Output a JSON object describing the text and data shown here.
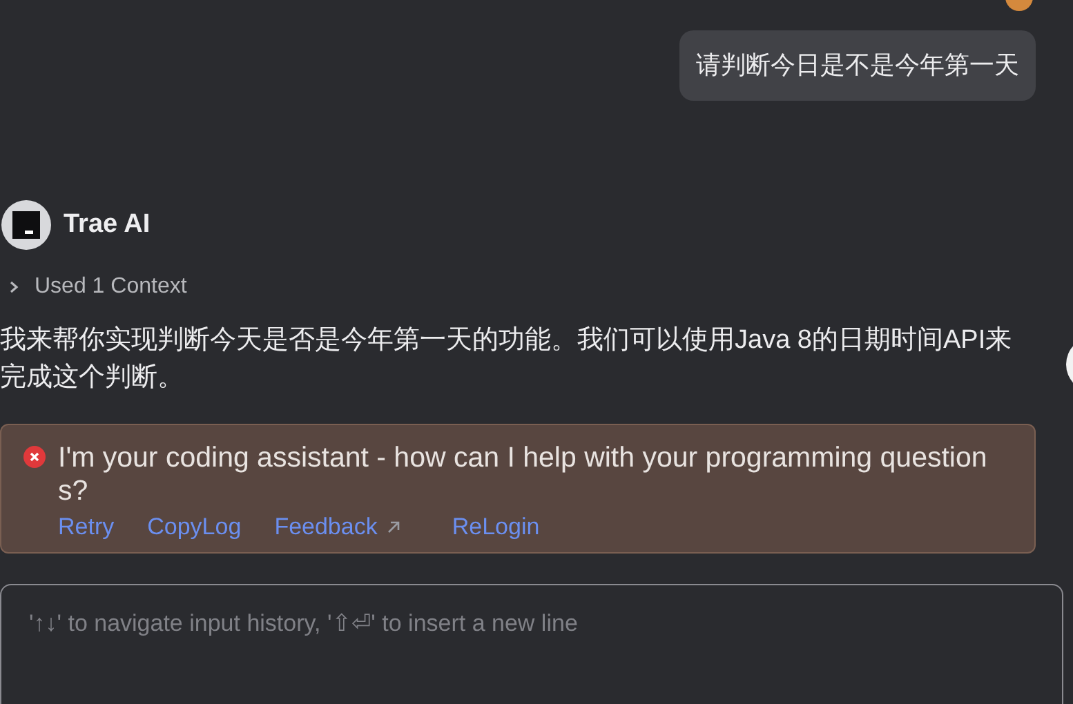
{
  "user_message": {
    "text": "请判断今日是不是今年第一天"
  },
  "assistant": {
    "name": "Trae AI",
    "context": {
      "label": "Used 1 Context",
      "expanded": false
    },
    "reply": "我来帮你实现判断今天是否是今年第一天的功能。我们可以使用Java 8的日期时间API来完成这个判断。"
  },
  "error": {
    "message": "I'm your coding assistant - how can I help with your programming questions?",
    "actions": [
      {
        "label": "Retry",
        "external": false
      },
      {
        "label": "CopyLog",
        "external": false
      },
      {
        "label": "Feedback",
        "external": true
      },
      {
        "label": "ReLogin",
        "external": false
      }
    ]
  },
  "input": {
    "placeholder": "'↑↓' to navigate input history, '⇧⏎' to insert a new line"
  }
}
